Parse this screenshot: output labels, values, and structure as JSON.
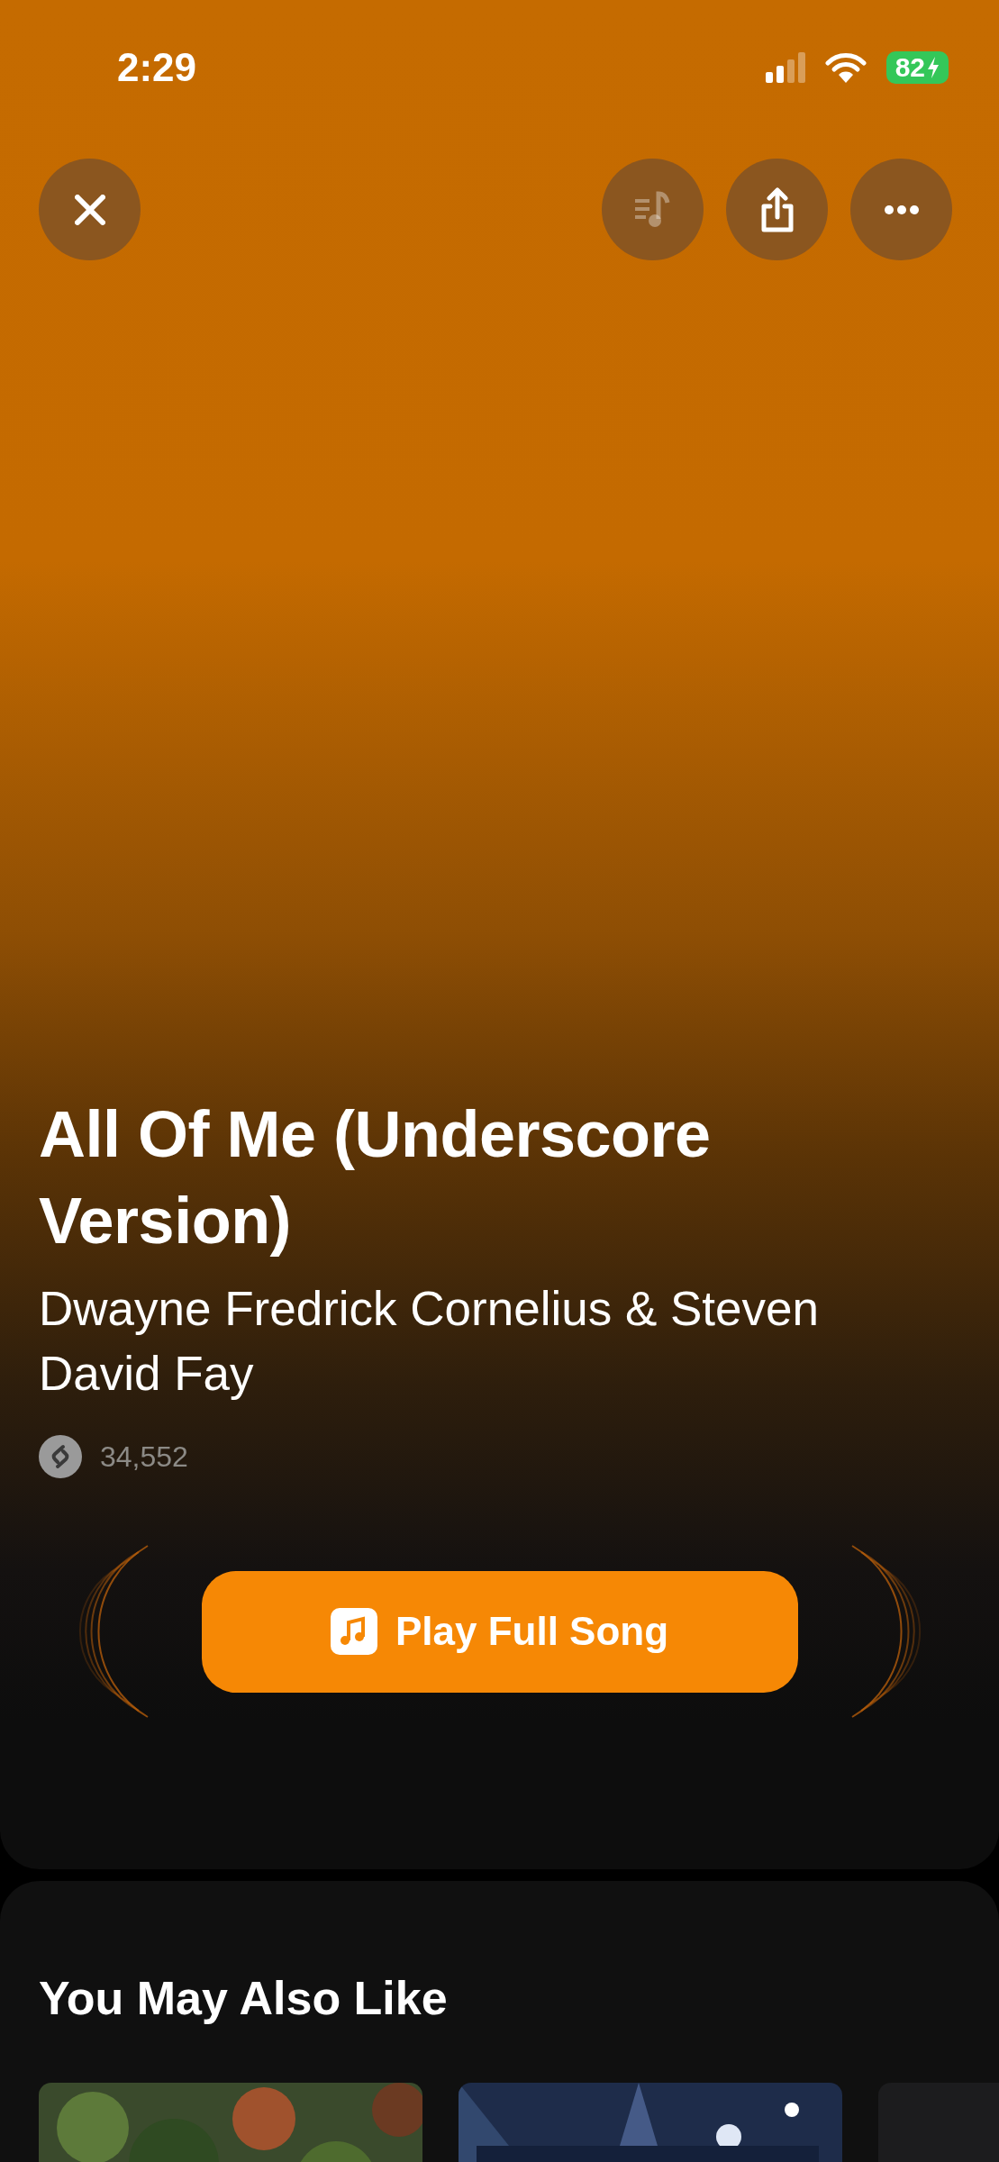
{
  "status_bar": {
    "time": "2:29",
    "battery": "82",
    "charging": true
  },
  "top_buttons": [
    {
      "kind": "close",
      "disabled": false
    },
    {
      "kind": "lyrics",
      "disabled": true
    },
    {
      "kind": "share",
      "disabled": false
    },
    {
      "kind": "more",
      "disabled": false
    }
  ],
  "track": {
    "title": "All Of Me (Underscore Version)",
    "artist": "Dwayne Fredrick Cornelius & Steven David Fay",
    "shazam_count": "34,552"
  },
  "play_button": {
    "label": "Play Full Song"
  },
  "recommendations": {
    "heading": "You May Also Like",
    "items": [
      {
        "kind": "picture",
        "color": "#3a4a2c"
      },
      {
        "kind": "picture",
        "color": "#1e2c4a"
      },
      {
        "kind": "blank",
        "color": "#1c1c1e"
      }
    ]
  }
}
